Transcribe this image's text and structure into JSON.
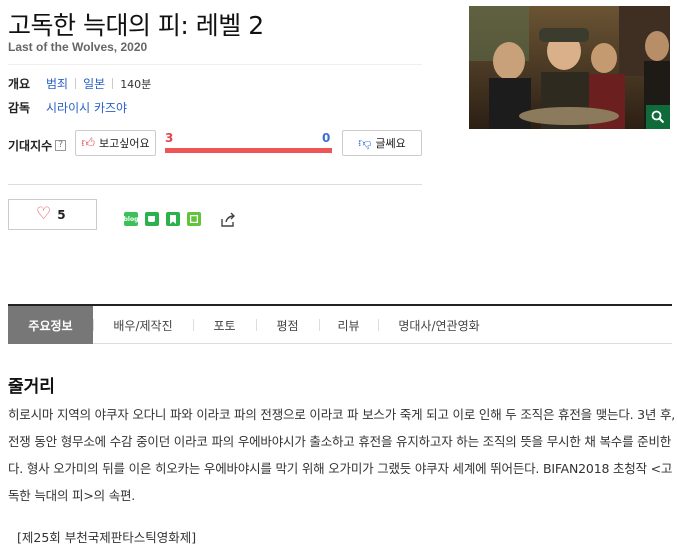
{
  "movie": {
    "title": "고독한 늑대의 피: 레벨 2",
    "subtitle": "Last of the Wolves, 2020"
  },
  "info": {
    "overview_label": "개요",
    "genre": "범죄",
    "country": "일본",
    "runtime": "140분",
    "director_label": "감독",
    "director": "시라이시 카즈야"
  },
  "expectation": {
    "label": "기대지수",
    "help": "?",
    "want_label": "보고싶어요",
    "want_count": "3",
    "no_label": "글쎄요",
    "no_count": "0",
    "want_ratio": 1.0
  },
  "like": {
    "count": "5"
  },
  "share": {
    "blog_icon": "blog-icon",
    "cafe_icon": "cafe-icon",
    "bookmark_icon": "bookmark-icon",
    "band_icon": "band-icon",
    "share_icon": "share-icon"
  },
  "tabs": [
    {
      "label": "주요정보"
    },
    {
      "label": "배우/제작진"
    },
    {
      "label": "포토"
    },
    {
      "label": "평점"
    },
    {
      "label": "리뷰"
    },
    {
      "label": "명대사/연관영화"
    }
  ],
  "synopsis": {
    "title": "줄거리",
    "body": "히로시마 지역의 야쿠자 오다니 파와 이라코 파의 전쟁으로 이라코 파 보스가 죽게 되고 이로 인해 두 조직은 휴전을 맺는다. 3년 후, 전쟁 동안 형무소에 수감 중이던 이라코 파의 우에바야시가 출소하고 휴전을 유지하고자 하는 조직의 뜻을 무시한 채 복수를 준비한다. 형사 오가미의 뒤를 이은 히오카는 우에바야시를 막기 위해 오가미가 그랬듯 야쿠자 세계에 뛰어든다. BIFAN2018 초청작 <고독한 늑대의 피>의 속편.",
    "festival": "[제25회 부천국제판타스틱영화제]"
  },
  "colors": {
    "accent_red": "#e0464e",
    "accent_blue": "#3b6fd6",
    "link": "#2a61c9",
    "tab_active": "#777777"
  }
}
